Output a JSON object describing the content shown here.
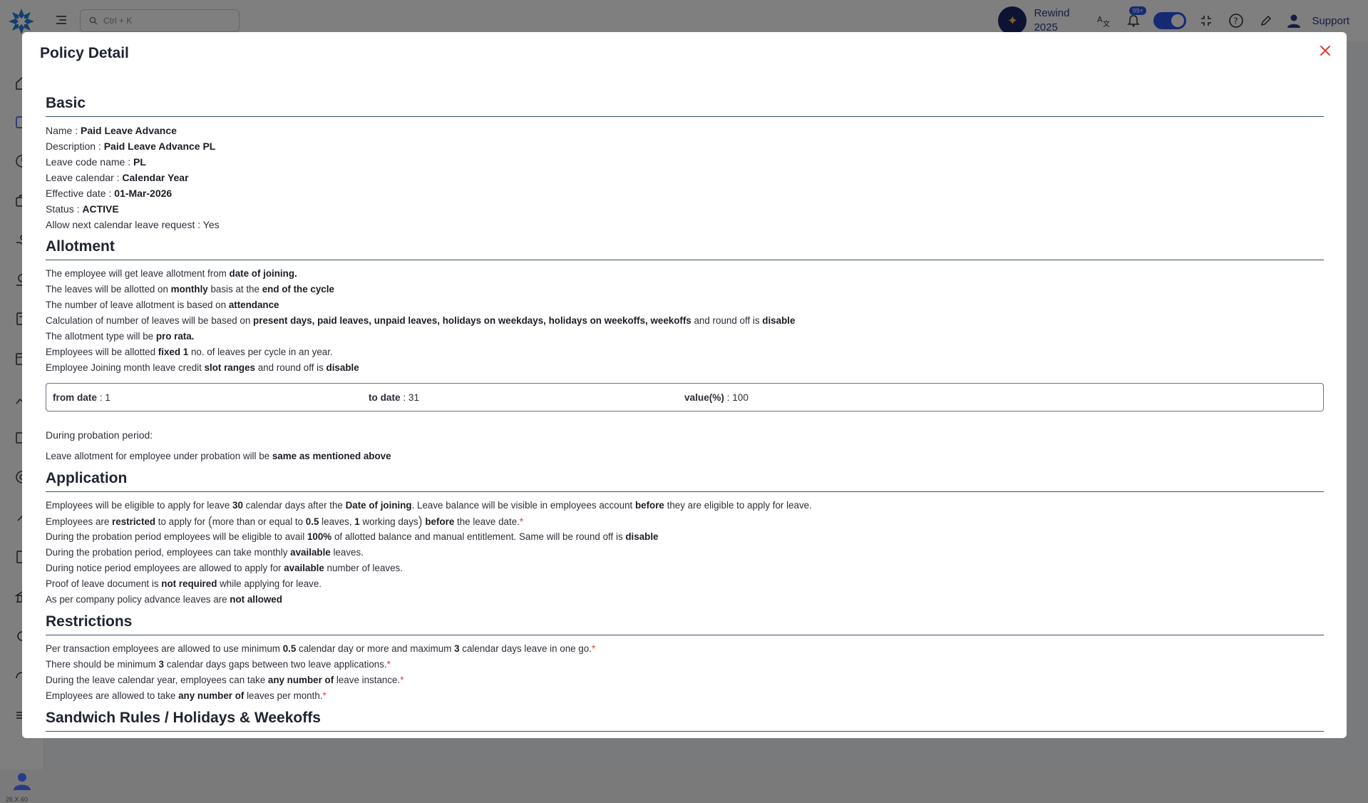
{
  "topbar": {
    "search_placeholder": "Ctrl + K",
    "rewind_label": "Rewind 2025",
    "notification_count": "99+",
    "support_label": "Support"
  },
  "sidebar": {
    "version": "26.X.60"
  },
  "modal": {
    "title": "Policy Detail"
  },
  "basic": {
    "title": "Basic",
    "fields": [
      {
        "label": "Name : ",
        "value": "Paid Leave Advance"
      },
      {
        "label": "Description : ",
        "value": "Paid Leave Advance PL"
      },
      {
        "label": "Leave code name : ",
        "value": "PL"
      },
      {
        "label": "Leave calendar : ",
        "value": "Calendar Year"
      },
      {
        "label": "Effective date : ",
        "value": "01-Mar-2026"
      },
      {
        "label": "Status : ",
        "value": "ACTIVE"
      }
    ],
    "allow_next": "Allow next calendar leave request : Yes"
  },
  "allotment": {
    "title": "Allotment",
    "l1": {
      "a": "The employee will get leave allotment from ",
      "b": "date of joining."
    },
    "l2": {
      "a": "The leaves will be allotted on ",
      "b": "monthly",
      "c": " basis at the ",
      "d": "end of the cycle"
    },
    "l3": {
      "a": "The number of leave allotment is based on ",
      "b": "attendance"
    },
    "l4": {
      "a": "Calculation of number of leaves will be based on ",
      "b": "present days, paid leaves, unpaid leaves, holidays on weekdays, holidays on weekoffs, weekoffs",
      "c": " and round off is ",
      "d": "disable"
    },
    "l5": {
      "a": "The allotment type will be ",
      "b": "pro rata."
    },
    "l6": {
      "a": "Employees will be allotted ",
      "b": "fixed 1",
      "c": " no. of leaves per cycle in an year."
    },
    "l7": {
      "a": "Employee Joining month leave credit ",
      "b": "slot ranges",
      "c": " and round off is ",
      "d": "disable"
    },
    "slot": {
      "from_label": "from date",
      "from_value": " : 1",
      "to_label": "to date",
      "to_value": " : 31",
      "value_label": "value(%)",
      "value_value": " : 100"
    },
    "probation_head": "During probation period:",
    "probation": {
      "a": "Leave allotment for employee under probation will be ",
      "b": "same as mentioned above"
    }
  },
  "application": {
    "title": "Application",
    "l1": {
      "a": "Employees will be eligible to apply for leave ",
      "b": "30",
      "c": " calendar days after the ",
      "d": "Date of joining",
      "e": ". Leave balance will be visible in employees account ",
      "f": "before",
      "g": " they are eligible to apply for leave."
    },
    "l2": {
      "a": "Employees are ",
      "b": "restricted",
      "c": " to apply for ",
      "d": "more than or equal to ",
      "e": "0.5",
      "f": " leaves, ",
      "g": "1",
      "h": " working days",
      "i": "before",
      "j": " the leave date.",
      "k": "*"
    },
    "l3": {
      "a": "During the probation period employees will be eligible to avail ",
      "b": "100%",
      "c": " of allotted balance and manual entitlement. Same will be round off is ",
      "d": "disable"
    },
    "l4": {
      "a": "During the probation period, employees can take monthly ",
      "b": "available",
      "c": " leaves."
    },
    "l5": {
      "a": "During notice period employees are allowed to apply for ",
      "b": "available",
      "c": " number of leaves."
    },
    "l6": {
      "a": "Proof of leave document is ",
      "b": "not required",
      "c": " while applying for leave."
    },
    "l7": {
      "a": "As per company policy advance leaves are ",
      "b": "not allowed"
    }
  },
  "restrictions": {
    "title": "Restrictions",
    "l1": {
      "a": "Per transaction employees are allowed to use minimum ",
      "b": "0.5",
      "c": " calendar day or more and maximum ",
      "d": "3",
      "e": " calendar days leave in one go.",
      "f": "*"
    },
    "l2": {
      "a": "There should be minimum ",
      "b": "3",
      "c": " calendar days gaps between two leave applications.",
      "d": "*"
    },
    "l3": {
      "a": "During the leave calendar year, employees can take ",
      "b": "any number of",
      "c": " leave instance.",
      "d": "*"
    },
    "l4": {
      "a": "Employees are allowed to take ",
      "b": "any number of",
      "c": " leaves per month.",
      "d": "*"
    }
  },
  "sandwich": {
    "title": "Sandwich Rules / Holidays & Weekoffs"
  }
}
